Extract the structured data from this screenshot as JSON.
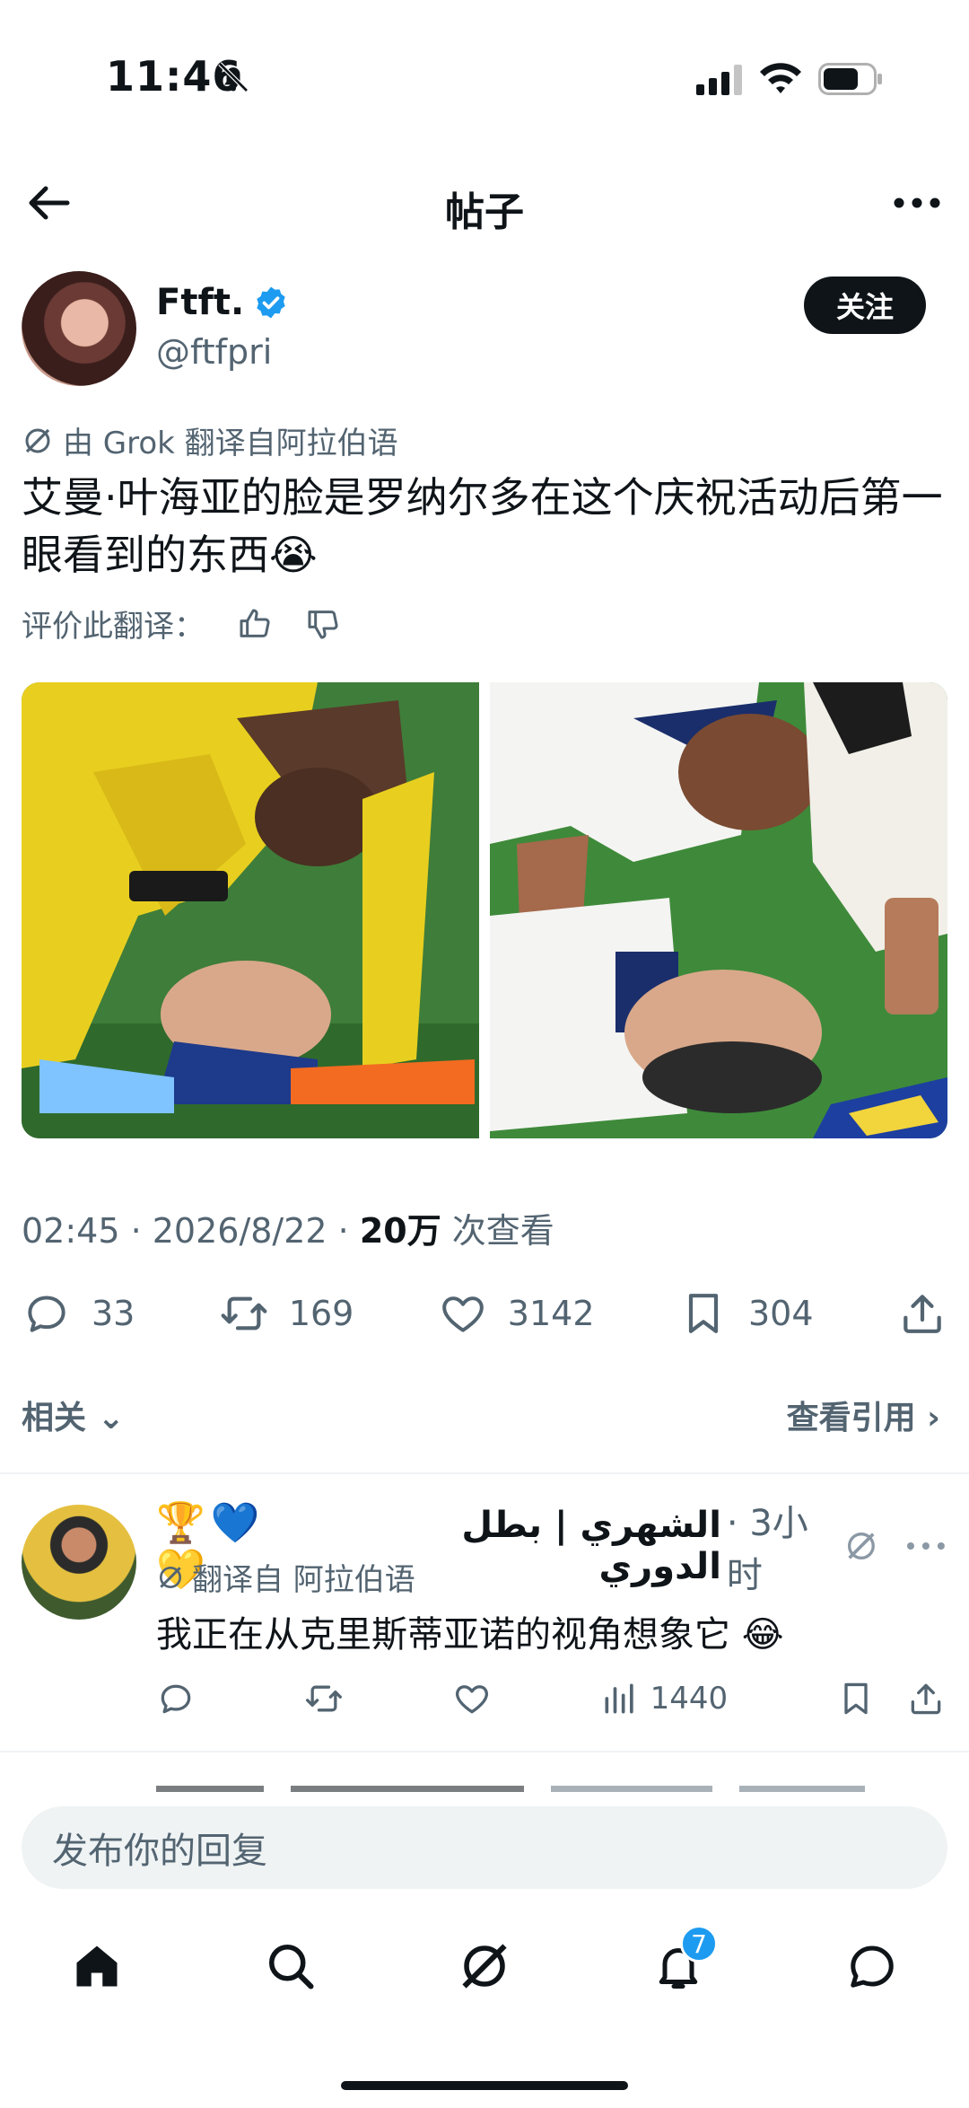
{
  "status": {
    "time": "11:46"
  },
  "header": {
    "title": "帖子"
  },
  "post": {
    "display_name": "Ftft.",
    "handle": "@ftfpri",
    "follow_label": "关注",
    "translated_note": "由 Grok 翻译自阿拉伯语",
    "text": "艾曼·叶海亚的脸是罗纳尔多在这个庆祝活动后第一眼看到的东西😭",
    "rate_label": "评价此翻译：",
    "meta_time": "02:45 · 2026/8/22 · ",
    "views_count": "20万",
    "views_label": " 次查看",
    "replies": "33",
    "reposts": "169",
    "likes": "3142",
    "bookmarks": "304"
  },
  "related": {
    "label": "相关",
    "quotes_label": "查看引用"
  },
  "reply": {
    "emojis": "🏆💙💛",
    "name": "الشهري | بطل الدوري",
    "time": "· 3小时",
    "translated_note": "翻译自 阿拉伯语",
    "text": "我正在从克里斯蒂亚诺的视角想象它 😂",
    "views": "1440"
  },
  "composer": {
    "placeholder": "发布你的回复"
  },
  "nav": {
    "notifications_badge": "7"
  },
  "colors": {
    "accent": "#1d9bf0",
    "text": "#0f1419",
    "muted": "#536471"
  }
}
